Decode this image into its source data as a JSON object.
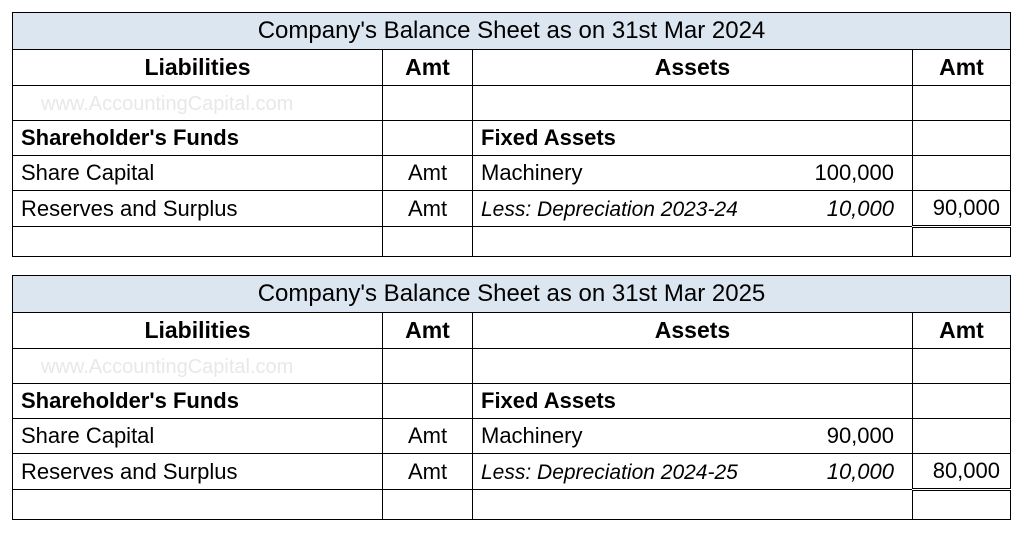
{
  "sheets": [
    {
      "title": "Company's Balance Sheet as on 31st Mar 2024",
      "col_liabilities": "Liabilities",
      "col_amt1": "Amt",
      "col_assets": "Assets",
      "col_amt2": "Amt",
      "watermark": "www.AccountingCapital.com",
      "shareholders_funds": "Shareholder's Funds",
      "share_capital": "Share Capital",
      "share_capital_amt": "Amt",
      "reserves": "Reserves and Surplus",
      "reserves_amt": "Amt",
      "fixed_assets": "Fixed Assets",
      "machinery_label": "Machinery",
      "machinery_val": "100,000",
      "dep_label": "Less: Depreciation 2023-24",
      "dep_val": "10,000",
      "net_val": "90,000"
    },
    {
      "title": "Company's Balance Sheet as on 31st Mar 2025",
      "col_liabilities": "Liabilities",
      "col_amt1": "Amt",
      "col_assets": "Assets",
      "col_amt2": "Amt",
      "watermark": "www.AccountingCapital.com",
      "shareholders_funds": "Shareholder's Funds",
      "share_capital": "Share Capital",
      "share_capital_amt": "Amt",
      "reserves": "Reserves and Surplus",
      "reserves_amt": "Amt",
      "fixed_assets": "Fixed Assets",
      "machinery_label": "Machinery",
      "machinery_val": "90,000",
      "dep_label": "Less: Depreciation 2024-25",
      "dep_val": "10,000",
      "net_val": "80,000"
    }
  ]
}
